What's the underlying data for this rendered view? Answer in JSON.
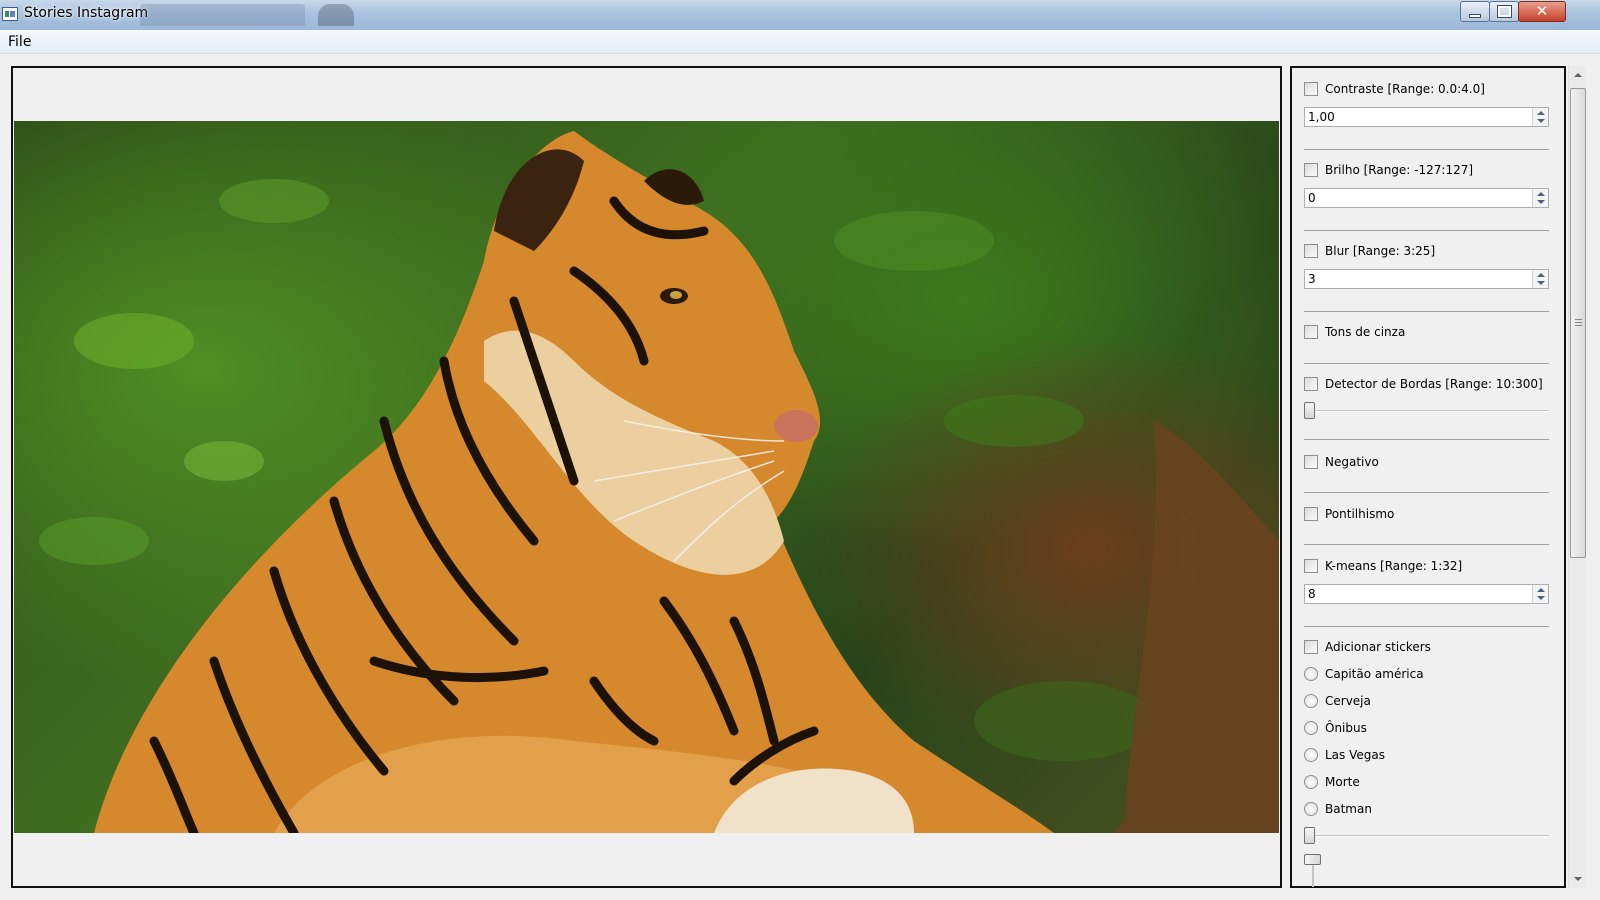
{
  "window": {
    "title": "Stories Instagram",
    "controls": [
      "minimize-icon",
      "maximize-icon",
      "close-icon"
    ]
  },
  "menu": {
    "file": "File"
  },
  "image": {
    "subject_icon": "photo-tiger"
  },
  "filters": {
    "contraste": {
      "label": "Contraste [Range: 0.0:4.0]",
      "value": "1,00"
    },
    "brilho": {
      "label": "Brilho [Range: -127:127]",
      "value": "0"
    },
    "blur": {
      "label": "Blur [Range: 3:25]",
      "value": "3"
    },
    "tons": {
      "label": "Tons de cinza"
    },
    "bordas": {
      "label": "Detector de Bordas [Range: 10:300]",
      "slider_fraction": 0
    },
    "negativo": {
      "label": "Negativo"
    },
    "pontilhismo": {
      "label": "Pontilhismo"
    },
    "kmeans": {
      "label": "K-means [Range: 1:32]",
      "value": "8"
    },
    "stickers": {
      "label": "Adicionar stickers",
      "options": [
        "Capitão américa",
        "Cerveja",
        "Ônibus",
        "Las Vegas",
        "Morte",
        "Batman"
      ]
    }
  },
  "colors": {
    "titlebar": "#a9c3df",
    "close_button": "#c6402a",
    "panel_bg": "#f0f0f0"
  }
}
